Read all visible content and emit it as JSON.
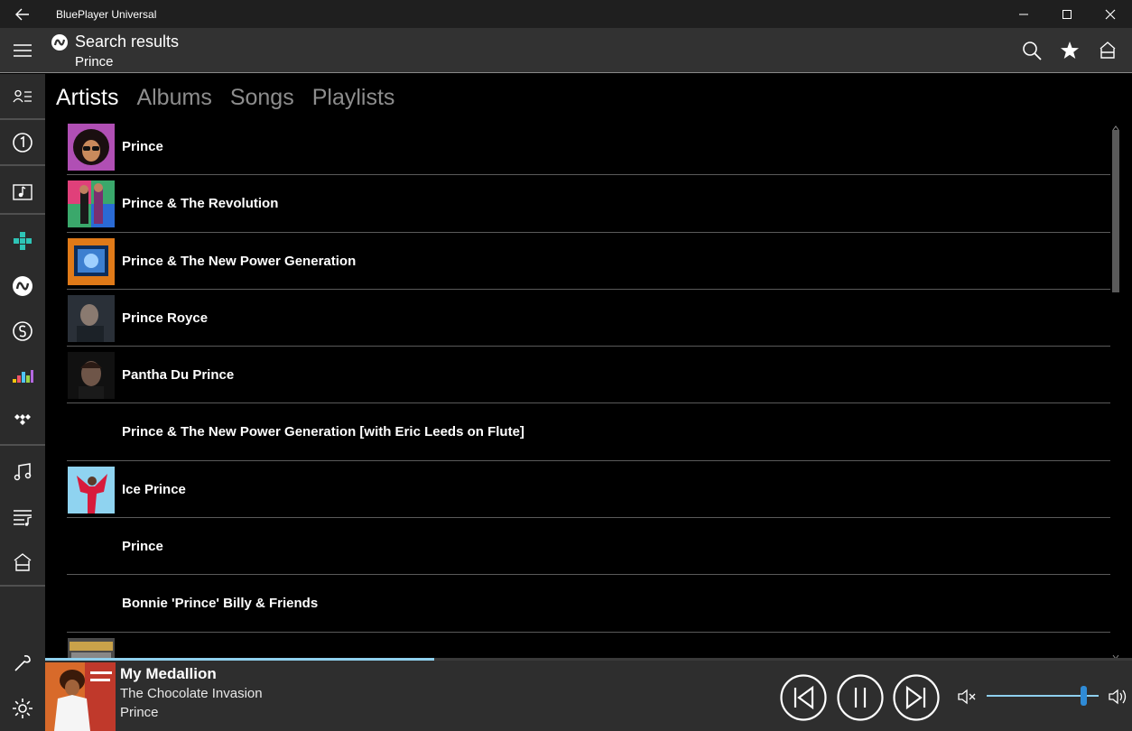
{
  "window": {
    "title": "BluePlayer Universal"
  },
  "header": {
    "title": "Search results",
    "subtitle": "Prince"
  },
  "tabs": [
    {
      "label": "Artists",
      "active": true
    },
    {
      "label": "Albums",
      "active": false
    },
    {
      "label": "Songs",
      "active": false
    },
    {
      "label": "Playlists",
      "active": false
    }
  ],
  "artists": [
    {
      "name": "Prince",
      "thumb": "afro-portrait"
    },
    {
      "name": "Prince & The Revolution",
      "thumb": "colorful-band"
    },
    {
      "name": "Prince & The New Power Generation",
      "thumb": "tv-frame"
    },
    {
      "name": "Prince Royce",
      "thumb": "dark-portrait"
    },
    {
      "name": "Pantha Du Prince",
      "thumb": "dark-face"
    },
    {
      "name": "Prince & The New Power Generation [with Eric Leeds on Flute]",
      "thumb": ""
    },
    {
      "name": "Ice Prince",
      "thumb": "red-figure"
    },
    {
      "name": "Prince",
      "thumb": ""
    },
    {
      "name": "Bonnie 'Prince' Billy & Friends",
      "thumb": ""
    },
    {
      "name": "",
      "thumb": "toolroom"
    }
  ],
  "player": {
    "title": "My Medallion",
    "album": "The Chocolate Invasion",
    "artist": "Prince",
    "progress": 0.358,
    "volume": 0.9
  },
  "icons": {
    "back": "back-arrow-icon",
    "minimize": "minimize-icon",
    "maximize": "maximize-icon",
    "close": "close-icon",
    "menu": "hamburger-icon",
    "search": "search-icon",
    "favorite": "star-icon",
    "home": "home-icon"
  },
  "colors": {
    "accent": "#8fd0ee",
    "slider": "#2f8bd6",
    "header": "#323232",
    "sidebar": "#2b2b2b"
  }
}
